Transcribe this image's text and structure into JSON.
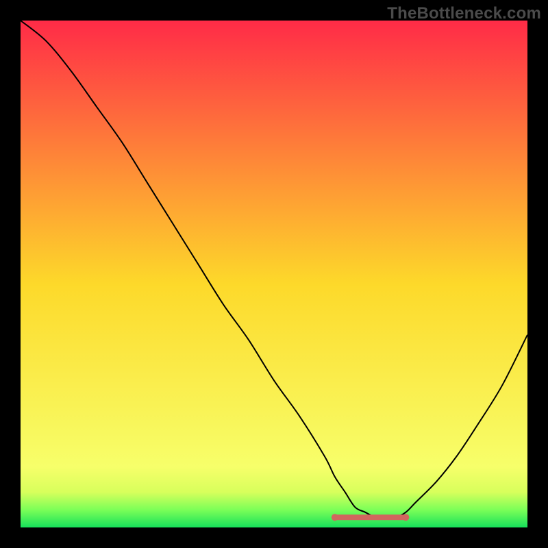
{
  "watermark": "TheBottleneck.com",
  "chart_data": {
    "type": "line",
    "title": "",
    "xlabel": "",
    "ylabel": "",
    "xlim": [
      0,
      100
    ],
    "ylim": [
      0,
      100
    ],
    "grid": false,
    "legend": null,
    "series": [
      {
        "name": "curve",
        "color": "#000000",
        "x": [
          0,
          5,
          10,
          15,
          20,
          25,
          30,
          35,
          40,
          45,
          50,
          55,
          60,
          62,
          64,
          66,
          68,
          70,
          72,
          74,
          76,
          78,
          82,
          86,
          90,
          95,
          100
        ],
        "y": [
          100,
          96,
          90,
          83,
          76,
          68,
          60,
          52,
          44,
          37,
          29,
          22,
          14,
          10,
          7,
          4,
          3,
          2,
          2,
          2,
          3,
          5,
          9,
          14,
          20,
          28,
          38
        ]
      }
    ],
    "flat_bottom_marker": {
      "color": "#d0665e",
      "x_start": 62,
      "x_end": 76,
      "y": 2
    },
    "background_gradient": {
      "stops": [
        {
          "offset": 0.0,
          "color": "#ff2b47"
        },
        {
          "offset": 0.52,
          "color": "#fdd92a"
        },
        {
          "offset": 0.88,
          "color": "#f7ff6a"
        },
        {
          "offset": 0.93,
          "color": "#d8ff5c"
        },
        {
          "offset": 0.965,
          "color": "#7cff58"
        },
        {
          "offset": 1.0,
          "color": "#16e05a"
        }
      ]
    }
  }
}
